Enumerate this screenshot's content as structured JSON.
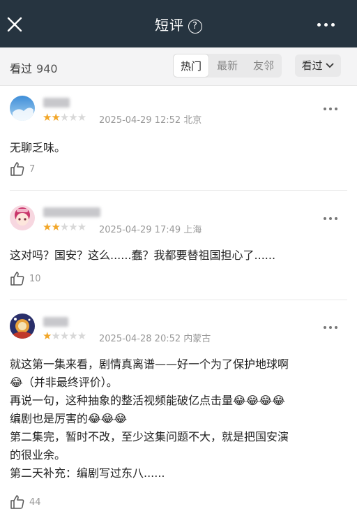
{
  "header": {
    "title": "短评",
    "help_icon": "?",
    "close_icon": "close-icon",
    "more_icon": "more-icon"
  },
  "filter": {
    "count_label": "看过",
    "count_value": "940",
    "tabs": [
      "热门",
      "最新",
      "友邻"
    ],
    "active_tab": 0,
    "sort_label": "看过"
  },
  "reviews": [
    {
      "stars": 2,
      "date": "2025-04-29 12:52",
      "location": "北京",
      "text": "无聊乏味。",
      "likes": "7"
    },
    {
      "stars": 2,
      "date": "2025-04-29 17:49",
      "location": "上海",
      "text": "这对吗？国安？这么......蠢？我都要替祖国担心了......",
      "likes": "10"
    },
    {
      "stars": 1,
      "date": "2025-04-28 20:52",
      "location": "内蒙古",
      "lines": [
        "就这第一集来看，剧情真离谱——好一个为了保护地球啊",
        "😂（并非最终评价）。",
        "再说一句，这种抽象的整活视频能破亿点击量😂😂😂😂",
        "编剧也是厉害的😂😂😂",
        "第二集完，暂时不改，至少这集问题不大，就是把国安演",
        "的很业余。",
        "第二天补充：编剧写过东八......"
      ],
      "likes": "44"
    }
  ],
  "colors": {
    "topbar": "#263440",
    "star_on": "#f2a72a",
    "star_off": "#d8d8d8",
    "meta": "#999999"
  }
}
